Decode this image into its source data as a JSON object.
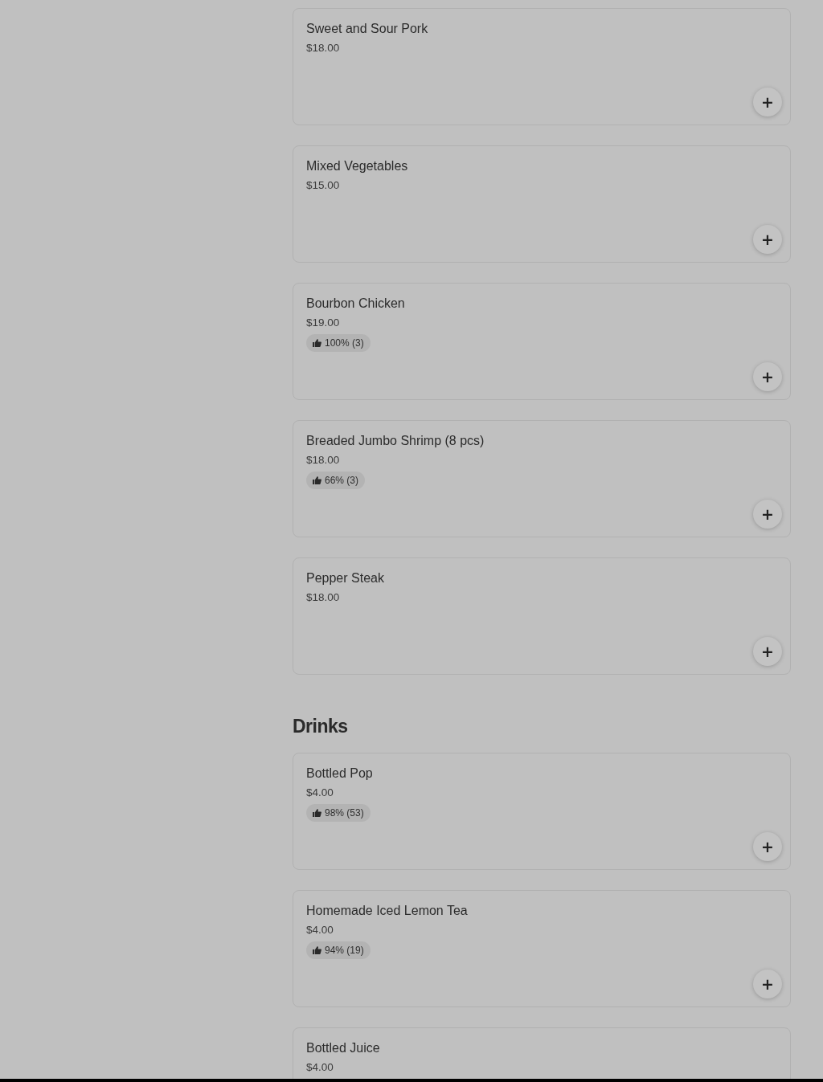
{
  "sections": [
    {
      "items": [
        {
          "name": "Sweet and Sour Pork",
          "price": "$18.00",
          "add": "+"
        },
        {
          "name": "Mixed Vegetables",
          "price": "$15.00",
          "add": "+"
        },
        {
          "name": "Bourbon Chicken",
          "price": "$19.00",
          "rating": "100% (3)",
          "add": "+"
        },
        {
          "name": "Breaded Jumbo Shrimp (8 pcs)",
          "price": "$18.00",
          "rating": "66% (3)",
          "add": "+"
        },
        {
          "name": "Pepper Steak",
          "price": "$18.00",
          "add": "+"
        }
      ]
    },
    {
      "title": "Drinks",
      "items": [
        {
          "name": "Bottled Pop",
          "price": "$4.00",
          "rating": "98% (53)",
          "add": "+"
        },
        {
          "name": "Homemade Iced Lemon Tea",
          "price": "$4.00",
          "rating": "94% (19)",
          "add": "+"
        },
        {
          "name": "Bottled Juice",
          "price": "$4.00"
        }
      ]
    }
  ]
}
